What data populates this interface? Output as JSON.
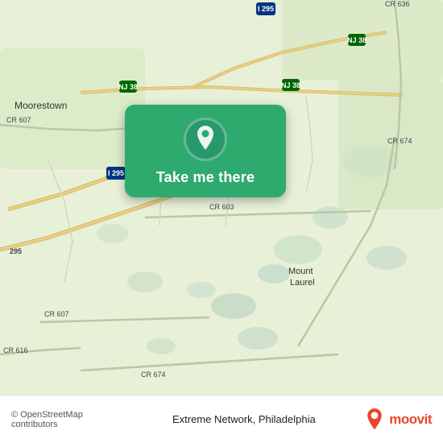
{
  "map": {
    "background_color": "#e8f0d8",
    "center_lat": 39.95,
    "center_lng": -74.91,
    "zoom": 12
  },
  "labels": {
    "moorestown": "Moorestown",
    "mount_laurel": "Mount\nLaurel",
    "cr607_1": "CR 607",
    "cr607_2": "CR 607",
    "cr674_1": "CR 674",
    "cr674_2": "CR 674",
    "cr603": "CR 603",
    "cr636": "CR 636",
    "nj38_1": "NJ 38",
    "nj38_2": "NJ 38",
    "nj38_3": "NJ 38",
    "i295_1": "I 295",
    "i295_2": "I 295",
    "i295_3": "295",
    "cr616": "CR 616"
  },
  "tooltip": {
    "label": "Take me there"
  },
  "bottom_bar": {
    "copyright": "© OpenStreetMap contributors",
    "location": "Extreme Network, Philadelphia",
    "moovit_brand": "moovit"
  }
}
